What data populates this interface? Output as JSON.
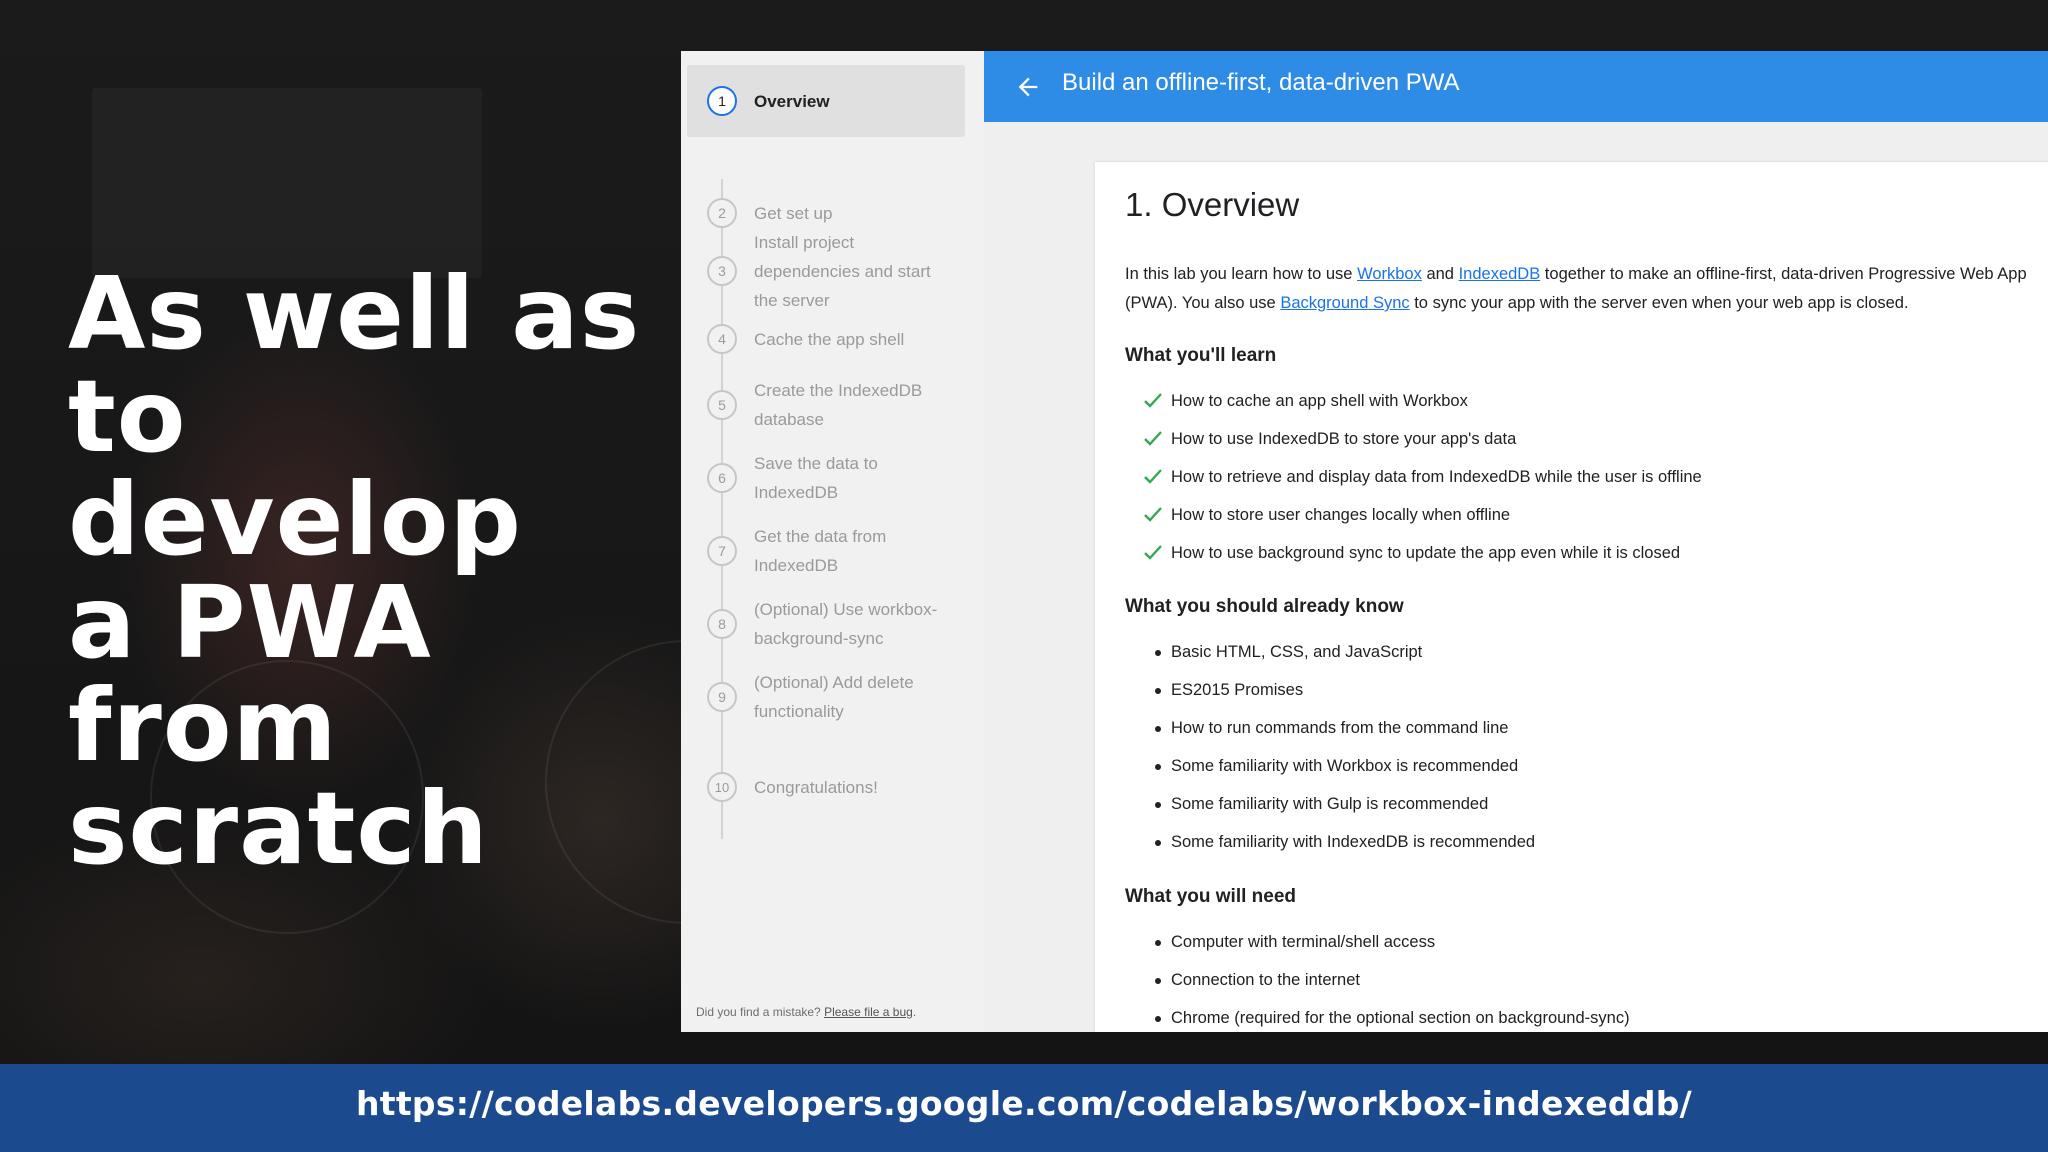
{
  "slide": {
    "headline_lines": [
      "As well as",
      "to develop",
      "a PWA",
      "from",
      "scratch"
    ],
    "url": "https://codelabs.developers.google.com/codelabs/workbox-indexeddb/"
  },
  "codelab": {
    "topbar": {
      "back_icon": "arrow-left-icon",
      "title": "Build an offline-first, data-driven PWA"
    },
    "steps": [
      {
        "num": "1",
        "label": "Overview",
        "active": true
      },
      {
        "num": "2",
        "label": "Get set up"
      },
      {
        "num": "3",
        "label": "Install project dependencies and start the server"
      },
      {
        "num": "4",
        "label": "Cache the app shell"
      },
      {
        "num": "5",
        "label": "Create the IndexedDB database"
      },
      {
        "num": "6",
        "label": "Save the data to IndexedDB"
      },
      {
        "num": "7",
        "label": "Get the data from IndexedDB"
      },
      {
        "num": "8",
        "label": "(Optional) Use workbox-background-sync"
      },
      {
        "num": "9",
        "label": "(Optional) Add delete functionality"
      },
      {
        "num": "10",
        "label": "Congratulations!"
      }
    ],
    "footer": {
      "text": "Did you find a mistake?",
      "link": "Please file a bug"
    },
    "content": {
      "heading": "1. Overview",
      "intro": {
        "t1": "In this lab you learn how to use ",
        "link1": "Workbox",
        "t2": " and ",
        "link2": "IndexedDB",
        "t3": " together to make an offline-first, data-driven Progressive Web App (PWA). You also use ",
        "link3": "Background Sync",
        "t4": " to sync your app with the server even when your web app is closed."
      },
      "learn_title": "What you'll learn",
      "learn": [
        "How to cache an app shell with Workbox",
        "How to use IndexedDB to store your app's data",
        "How to retrieve and display data from IndexedDB while the user is offline",
        "How to store user changes locally when offline",
        "How to use background sync to update the app even while it is closed"
      ],
      "know_title": "What you should already know",
      "know": [
        "Basic HTML, CSS, and JavaScript",
        "ES2015 Promises",
        "How to run commands from the command line",
        "Some familiarity with Workbox is recommended",
        "Some familiarity with Gulp is recommended",
        "Some familiarity with IndexedDB is recommended"
      ],
      "need_title": "What you will need",
      "need": [
        "Computer with terminal/shell access",
        "Connection to the internet",
        "Chrome (required for the optional section on background-sync)"
      ]
    },
    "colors": {
      "topbar": "#2e8ce6",
      "link": "#1a73e8",
      "check": "#34a853",
      "banner": "#1b4a8f"
    }
  }
}
